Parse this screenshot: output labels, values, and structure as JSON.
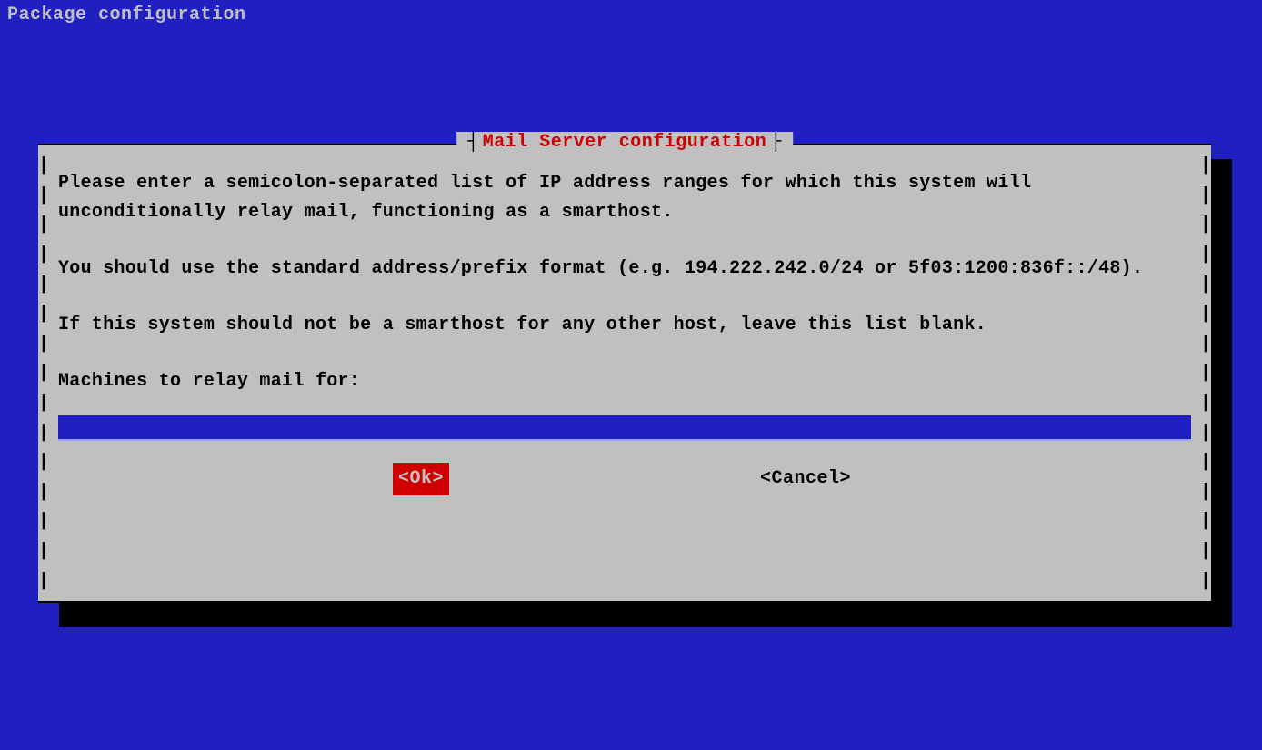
{
  "header": {
    "title": "Package configuration"
  },
  "dialog": {
    "title": "Mail Server configuration",
    "paragraph1": "Please enter a semicolon-separated list of IP address ranges for which this system will unconditionally relay mail, functioning as a smarthost.",
    "paragraph2": "You should use the standard address/prefix format (e.g. 194.222.242.0/24 or 5f03:1200:836f::/48).",
    "paragraph3": "If this system should not be a smarthost for any other host, leave this list blank.",
    "prompt_label": "Machines to relay mail for:",
    "input_value": "",
    "buttons": {
      "ok": "<Ok>",
      "cancel": "<Cancel>"
    }
  }
}
